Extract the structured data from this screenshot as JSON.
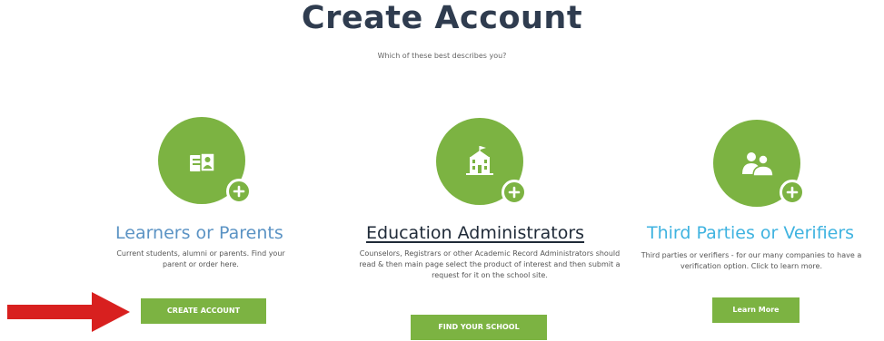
{
  "header": {
    "title": "Create Account",
    "subtitle": "Which of these best describes you?"
  },
  "colors": {
    "accent_green": "#7cb342",
    "learners_title": "#5b93c4",
    "admins_title": "#1f2a38",
    "third_title": "#3fb3e0",
    "arrow": "#d8201f"
  },
  "columns": [
    {
      "icon": "student-id-icon",
      "title": "Learners or Parents",
      "description": "Current students, alumni or parents. Find your parent or order here.",
      "button_label": "CREATE ACCOUNT"
    },
    {
      "icon": "school-building-icon",
      "title": "Education Administrators",
      "description": "Counselors, Registrars or other Academic Record Administrators should read & then main page select the product of interest and then submit a request for it on the school site.",
      "button_label": "FIND YOUR SCHOOL"
    },
    {
      "icon": "people-icon",
      "title": "Third Parties or Verifiers",
      "description": "Third parties or verifiers - for our many companies to have a verification option. Click to learn more.",
      "button_label": "Learn More"
    }
  ]
}
